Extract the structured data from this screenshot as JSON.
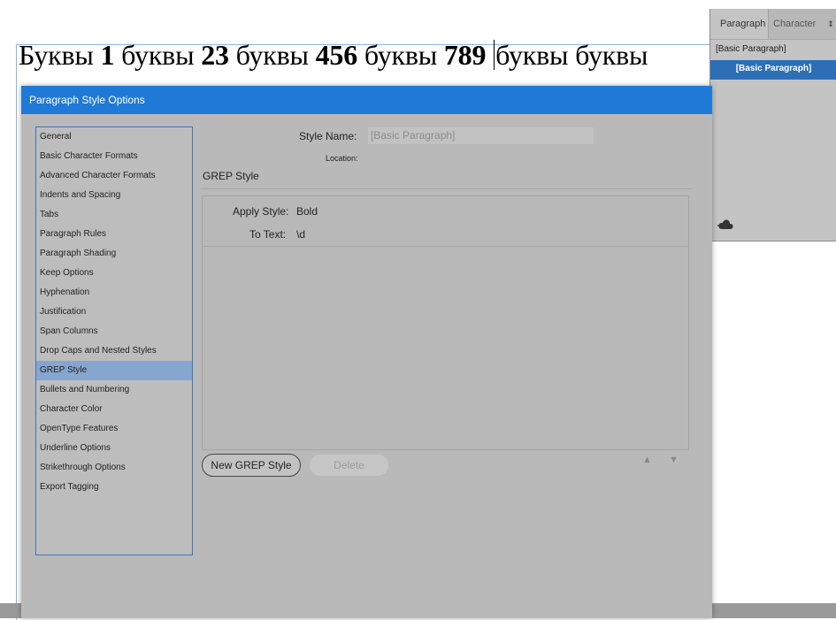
{
  "document": {
    "segments": [
      {
        "text": "Буквы ",
        "bold": false
      },
      {
        "text": "1",
        "bold": true
      },
      {
        "text": " буквы ",
        "bold": false
      },
      {
        "text": "23",
        "bold": true
      },
      {
        "text": " буквы ",
        "bold": false
      },
      {
        "text": "456",
        "bold": true
      },
      {
        "text": " буквы ",
        "bold": false
      },
      {
        "text": "789",
        "bold": true
      },
      {
        "text": " ",
        "bold": false
      },
      {
        "caret": true
      },
      {
        "text": "буквы буквы",
        "bold": false
      }
    ]
  },
  "panel": {
    "tabs": [
      "Paragraph Styles",
      "Character"
    ],
    "menu_icon": "panel-menu-icon",
    "items": [
      "[Basic Paragraph]",
      "[Basic Paragraph]"
    ],
    "footer_icon": "cloud-sync-icon"
  },
  "dialog": {
    "title": "Paragraph Style Options",
    "categories": [
      "General",
      "Basic Character Formats",
      "Advanced Character Formats",
      "Indents and Spacing",
      "Tabs",
      "Paragraph Rules",
      "Paragraph Shading",
      "Keep Options",
      "Hyphenation",
      "Justification",
      "Span Columns",
      "Drop Caps and Nested Styles",
      "GREP Style",
      "Bullets and Numbering",
      "Character Color",
      "OpenType Features",
      "Underline Options",
      "Strikethrough Options",
      "Export Tagging"
    ],
    "selected_category": "GREP Style",
    "style_name_label": "Style Name:",
    "style_name_value": "[Basic Paragraph]",
    "location_label": "Location:",
    "section_title": "GREP Style",
    "grep": {
      "apply_style_label": "Apply Style:",
      "apply_style_value": "Bold",
      "to_text_label": "To Text:",
      "to_text_value": "\\d"
    },
    "buttons": {
      "new_grep": "New GREP Style",
      "delete": "Delete",
      "move_up": "▲",
      "move_down": "▼"
    }
  },
  "colors": {
    "title_bar": "#1f7ad7",
    "selected_category": "#86a6cf",
    "panel_selected": "#2d6fb7"
  }
}
